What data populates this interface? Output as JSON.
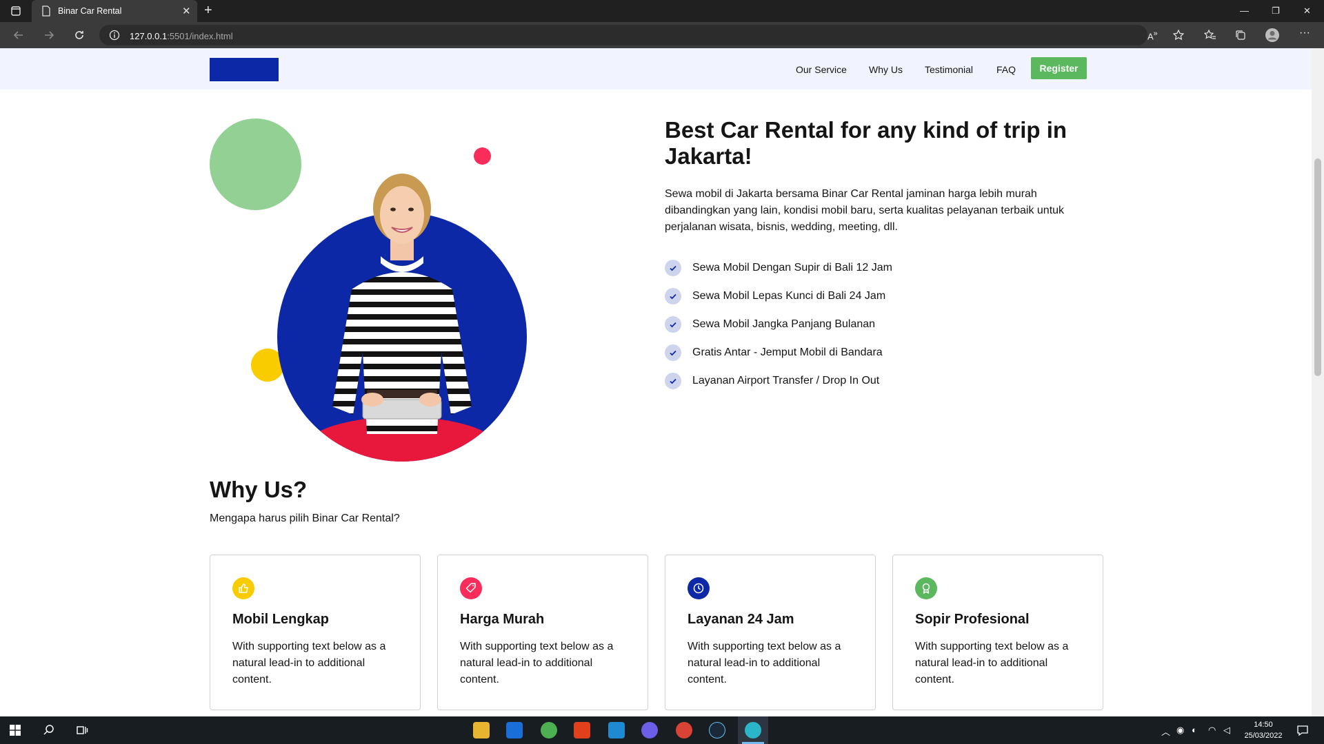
{
  "browser": {
    "tab_title": "Binar Car Rental",
    "url_host": "127.0.0.1",
    "url_rest": ":5501/index.html"
  },
  "navbar": {
    "links": [
      "Our Service",
      "Why Us",
      "Testimonial",
      "FAQ"
    ],
    "register_label": "Register"
  },
  "hero": {
    "title": "Best Car Rental for any kind of trip in Jakarta!",
    "description": "Sewa mobil di Jakarta bersama Binar Car Rental jaminan harga lebih murah dibandingkan yang lain, kondisi mobil baru, serta kualitas pelayanan terbaik untuk perjalanan wisata, bisnis, wedding, meeting, dll.",
    "checklist": [
      "Sewa Mobil Dengan Supir di Bali 12 Jam",
      "Sewa Mobil Lepas Kunci di Bali 24 Jam",
      "Sewa Mobil Jangka Panjang Bulanan",
      "Gratis Antar - Jemput Mobil di Bandara",
      "Layanan Airport Transfer / Drop In Out"
    ]
  },
  "why_us": {
    "title": "Why Us?",
    "subtitle": "Mengapa harus pilih Binar Car Rental?",
    "cards": [
      {
        "icon": "thumbs-up-icon",
        "color": "#f9cc00",
        "title": "Mobil Lengkap",
        "text": "With supporting text below as a natural lead-in to additional content."
      },
      {
        "icon": "price-tag-icon",
        "color": "#fa2c5a",
        "title": "Harga Murah",
        "text": "With supporting text below as a natural lead-in to additional content."
      },
      {
        "icon": "clock-icon",
        "color": "#0d28a6",
        "title": "Layanan 24 Jam",
        "text": "With supporting text below as a natural lead-in to additional content."
      },
      {
        "icon": "award-icon",
        "color": "#5cb85f",
        "title": "Sopir Profesional",
        "text": "With supporting text below as a natural lead-in to additional content."
      }
    ]
  },
  "colors": {
    "brand_blue": "#0d28a6",
    "register_green": "#5cb85f",
    "navbar_bg": "#f1f3ff"
  },
  "taskbar": {
    "time": "14:50",
    "date": "25/03/2022"
  }
}
